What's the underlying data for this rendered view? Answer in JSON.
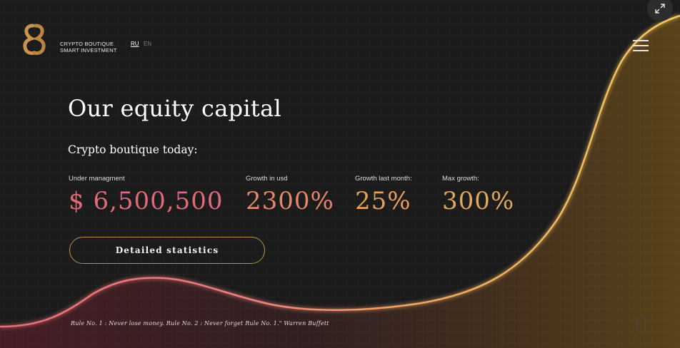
{
  "brand": {
    "line1": "CRYPTO BOUTIQUE",
    "line2": "SMART INVESTMENT",
    "logo_color": "#c9954e"
  },
  "languages": [
    "RU",
    "EN"
  ],
  "colors": {
    "background": "#1b1b1b",
    "pink": "#e9707a",
    "gold": "#f2c15b",
    "button_border": "#b0914e"
  },
  "hero": {
    "title": "Our equity capital",
    "subtitle": "Crypto boutique today:",
    "stats": [
      {
        "label": "Under managment",
        "value": "$ 6,500,500",
        "color": "#e06b78"
      },
      {
        "label": "Growth in usd",
        "value": "2300%",
        "color": "#e3876a"
      },
      {
        "label": "Growth last month:",
        "value": "25%",
        "color": "#e6a05c"
      },
      {
        "label": "Max growth:",
        "value": "300%",
        "color": "#e0a85a"
      }
    ],
    "button": "Detailed statistics"
  },
  "quote": "Rule No. 1 : Never lose money. Rule No. 2 : Never forget Rule No. 1.\" Warren Buffett",
  "icons": {
    "fullscreen": "expand-icon",
    "menu": "hamburger-icon",
    "scroll": "mouse-icon"
  }
}
